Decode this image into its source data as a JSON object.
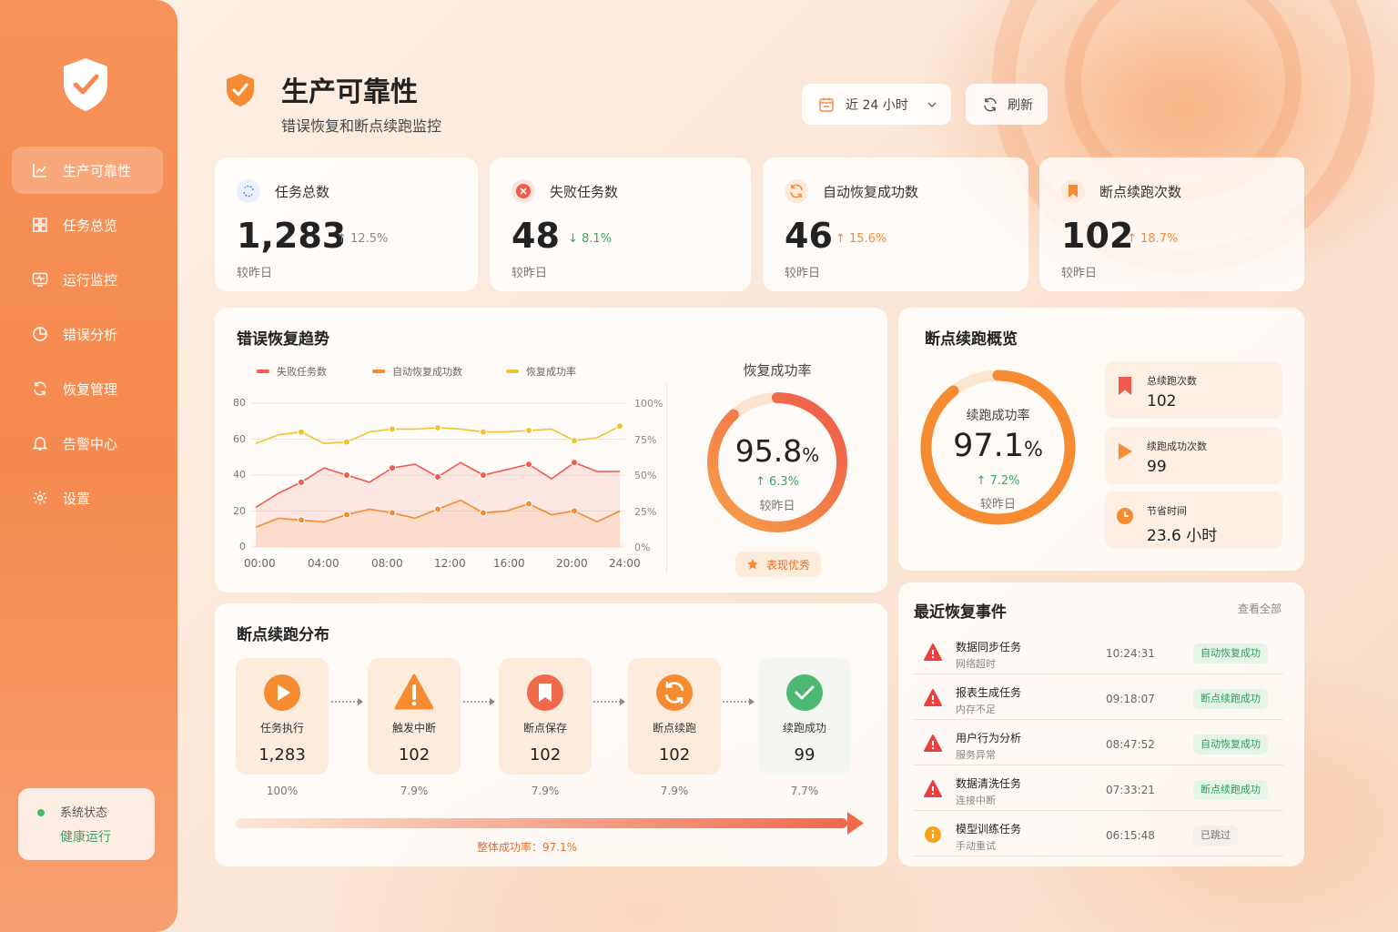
{
  "app": {
    "title": "生产可靠性",
    "subtitle": "错误恢复和断点续跑监控"
  },
  "sidebar": {
    "items": [
      {
        "label": "生产可靠性",
        "icon": "chart-line-icon",
        "active": true
      },
      {
        "label": "任务总览",
        "icon": "grid-icon"
      },
      {
        "label": "运行监控",
        "icon": "monitor-icon"
      },
      {
        "label": "错误分析",
        "icon": "pie-icon"
      },
      {
        "label": "恢复管理",
        "icon": "refresh-icon"
      },
      {
        "label": "告警中心",
        "icon": "bell-icon"
      },
      {
        "label": "设置",
        "icon": "gear-icon"
      }
    ],
    "status": {
      "label": "系统状态",
      "value": "健康运行"
    }
  },
  "toolbar": {
    "range_label": "近 24 小时",
    "refresh_label": "刷新"
  },
  "stats": [
    {
      "label": "任务总数",
      "value": "1,283",
      "change": "↑ 12.5%",
      "sub": "较昨日",
      "icon": "task-icon"
    },
    {
      "label": "失败任务数",
      "value": "48",
      "change": "↓ 8.1%",
      "sub": "较昨日",
      "icon": "error-icon"
    },
    {
      "label": "自动恢复成功数",
      "value": "46",
      "change": "↑ 15.6%",
      "sub": "较昨日",
      "icon": "refresh-icon"
    },
    {
      "label": "断点续跑次数",
      "value": "102",
      "change": "↑ 18.7%",
      "sub": "较昨日",
      "icon": "bookmark-icon"
    }
  ],
  "trend": {
    "title": "错误恢复趋势",
    "legend": [
      "失败任务数",
      "自动恢复成功数",
      "恢复成功率"
    ],
    "y_left": [
      "80",
      "60",
      "40",
      "20",
      "0"
    ],
    "y_right": [
      "100%",
      "75%",
      "50%",
      "25%",
      "0%"
    ],
    "x_labels": [
      "00:00",
      "04:00",
      "08:00",
      "12:00",
      "16:00",
      "20:00",
      "24:00"
    ]
  },
  "chart_data": {
    "type": "line",
    "x": [
      "00:00",
      "01:30",
      "03:00",
      "04:30",
      "06:00",
      "07:30",
      "09:00",
      "10:30",
      "12:00",
      "13:30",
      "15:00",
      "16:30",
      "18:00",
      "19:30",
      "21:00",
      "22:30",
      "24:00"
    ],
    "series": [
      {
        "name": "失败任务数",
        "axis": "left",
        "values": [
          22,
          30,
          36,
          44,
          40,
          36,
          44,
          46,
          39,
          47,
          40,
          43,
          46,
          38,
          47,
          42,
          42
        ]
      },
      {
        "name": "自动恢复成功数",
        "axis": "left",
        "values": [
          11,
          16,
          15,
          14,
          18,
          21,
          19,
          16,
          21,
          26,
          19,
          20,
          24,
          18,
          20,
          14,
          20
        ]
      },
      {
        "name": "恢复成功率",
        "axis": "right",
        "values": [
          72,
          78,
          80,
          72,
          73,
          80,
          82,
          82,
          83,
          82,
          80,
          80,
          81,
          82,
          74,
          76,
          84
        ]
      }
    ],
    "ylim_left": [
      0,
      80
    ],
    "ylim_right": [
      0,
      100
    ],
    "grid": true
  },
  "recovery_rate": {
    "title": "恢复成功率",
    "value": "95.8",
    "unit": "%",
    "percent": 95.8,
    "change": "↑ 6.3%",
    "sub": "较昨日",
    "badge": "表现优秀"
  },
  "breakpoint": {
    "title": "断点续跑概览",
    "ring_label": "续跑成功率",
    "value": "97.1",
    "unit": "%",
    "percent": 97.1,
    "change": "↑ 7.2%",
    "sub": "较昨日",
    "items": [
      {
        "label": "总续跑次数",
        "value": "102",
        "icon": "bookmark-icon"
      },
      {
        "label": "续跑成功次数",
        "value": "99",
        "icon": "play-icon"
      },
      {
        "label": "节省时间",
        "value": "23.6 小时",
        "icon": "clock-icon"
      }
    ]
  },
  "distribution": {
    "title": "断点续跑分布",
    "steps": [
      {
        "label": "任务执行",
        "value": "1,283",
        "pct": "100%",
        "icon": "play-icon"
      },
      {
        "label": "触发中断",
        "value": "102",
        "pct": "7.9%",
        "icon": "warning-icon"
      },
      {
        "label": "断点保存",
        "value": "102",
        "pct": "7.9%",
        "icon": "bookmark-icon"
      },
      {
        "label": "断点续跑",
        "value": "102",
        "pct": "7.9%",
        "icon": "refresh-icon"
      },
      {
        "label": "续跑成功",
        "value": "99",
        "pct": "7.7%",
        "icon": "check-icon"
      }
    ],
    "overall": "整体成功率：97.1%"
  },
  "events": {
    "title": "最近恢复事件",
    "view_all": "查看全部",
    "rows": [
      {
        "name": "数据同步任务",
        "desc": "网络超时",
        "time": "10:24:31",
        "status": "自动恢复成功",
        "kind": "ok",
        "icon": "error-icon"
      },
      {
        "name": "报表生成任务",
        "desc": "内存不足",
        "time": "09:18:07",
        "status": "断点续跑成功",
        "kind": "ok",
        "icon": "error-icon"
      },
      {
        "name": "用户行为分析",
        "desc": "服务异常",
        "time": "08:47:52",
        "status": "自动恢复成功",
        "kind": "ok",
        "icon": "error-icon"
      },
      {
        "name": "数据清洗任务",
        "desc": "连接中断",
        "time": "07:33:21",
        "status": "断点续跑成功",
        "kind": "ok",
        "icon": "error-icon"
      },
      {
        "name": "模型训练任务",
        "desc": "手动重试",
        "time": "06:15:48",
        "status": "已跳过",
        "kind": "skip",
        "icon": "info-icon"
      }
    ]
  },
  "colors": {
    "accent": "#f58a4f",
    "red": "#ee5a4b",
    "orange": "#f68b32",
    "yellow": "#f2c230",
    "green": "#3aa862"
  }
}
